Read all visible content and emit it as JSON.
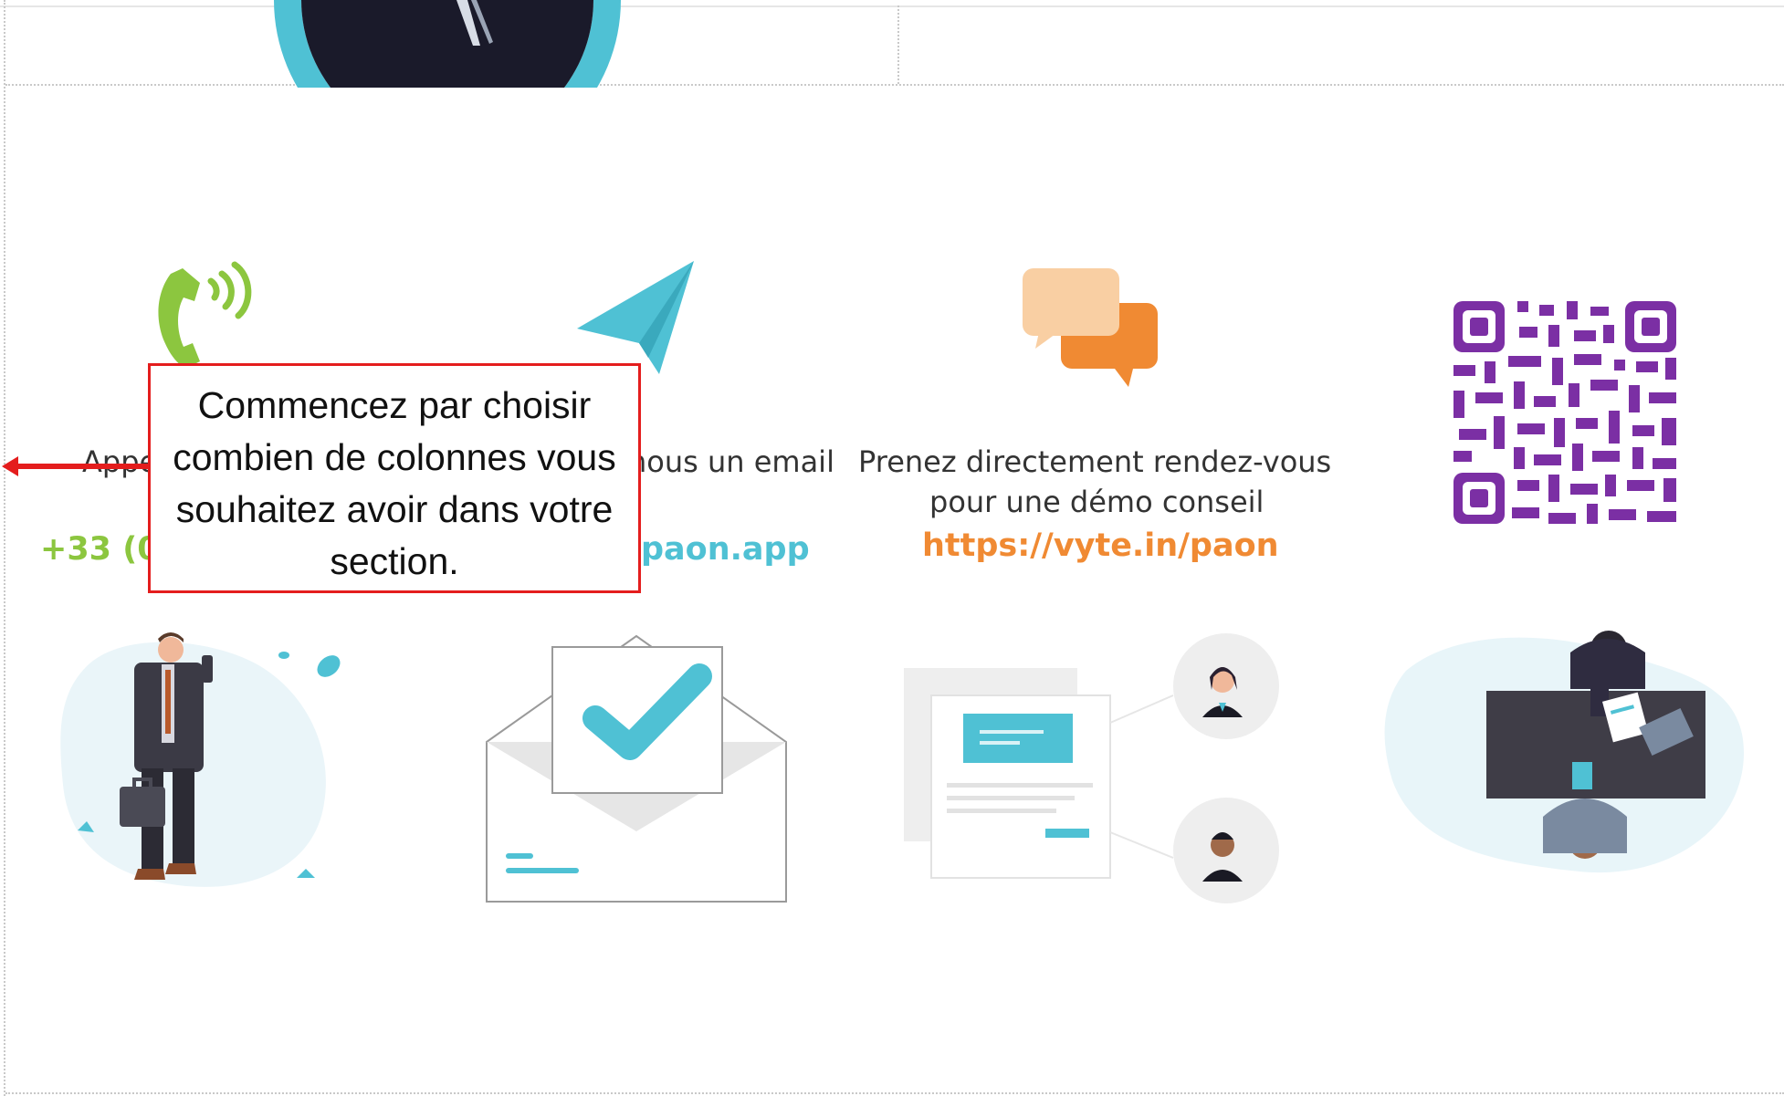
{
  "contacts": [
    {
      "text": "Appelez-nous",
      "link": "+33 (0)"
    },
    {
      "text": "Envoyez-nous un email",
      "link": "paon.app"
    },
    {
      "text": "Prenez directement rendez-vous",
      "text2": "pour une démo conseil",
      "link": "https://vyte.in/paon"
    }
  ],
  "tooltip": {
    "text": "Commencez par choisir combien de colonnes vous souhaitez avoir dans votre section."
  },
  "colors": {
    "phone": "#8cc63f",
    "teal": "#4fc1d4",
    "orange": "#f08a33",
    "qr": "#7b2fa4",
    "callout": "#e41d1d"
  },
  "icons": [
    "phone-icon",
    "paper-plane-icon",
    "chat-bubbles-icon",
    "qr-code"
  ]
}
